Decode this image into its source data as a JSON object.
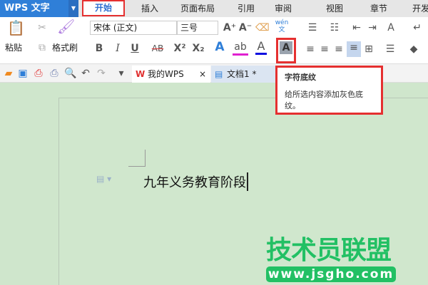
{
  "app": {
    "title": "WPS 文字"
  },
  "menu_tabs": [
    "开始",
    "插入",
    "页面布局",
    "引用",
    "审阅",
    "视图",
    "章节",
    "开发"
  ],
  "ribbon": {
    "paste": "粘贴",
    "format_painter": "格式刷",
    "font_name": "宋体 (正文)",
    "font_size": "三号",
    "bold": "B",
    "italic": "I",
    "underline": "U",
    "strikethrough": "AB",
    "superscript": "X²",
    "subscript": "X₂",
    "grow_font": "A⁺",
    "shrink_font": "A⁻",
    "phonetic": "wén文",
    "char_shading": "A",
    "font_color": "A",
    "highlight": "ab",
    "text_effect": "A"
  },
  "doc_tabs": [
    {
      "label": "我的WPS",
      "close": "×"
    },
    {
      "label": "文档1 *"
    }
  ],
  "tooltip": {
    "title": "字符底纹",
    "body": "给所选内容添加灰色底纹。"
  },
  "document": {
    "text": "九年义务教育阶段"
  },
  "watermark": {
    "text": "技术员联盟",
    "url": "www.jsgho.com"
  },
  "colors": {
    "accent": "#2f7fd8",
    "highlight_red": "#e53030",
    "page_bg": "#d0e7cd",
    "watermark": "#22c064"
  }
}
